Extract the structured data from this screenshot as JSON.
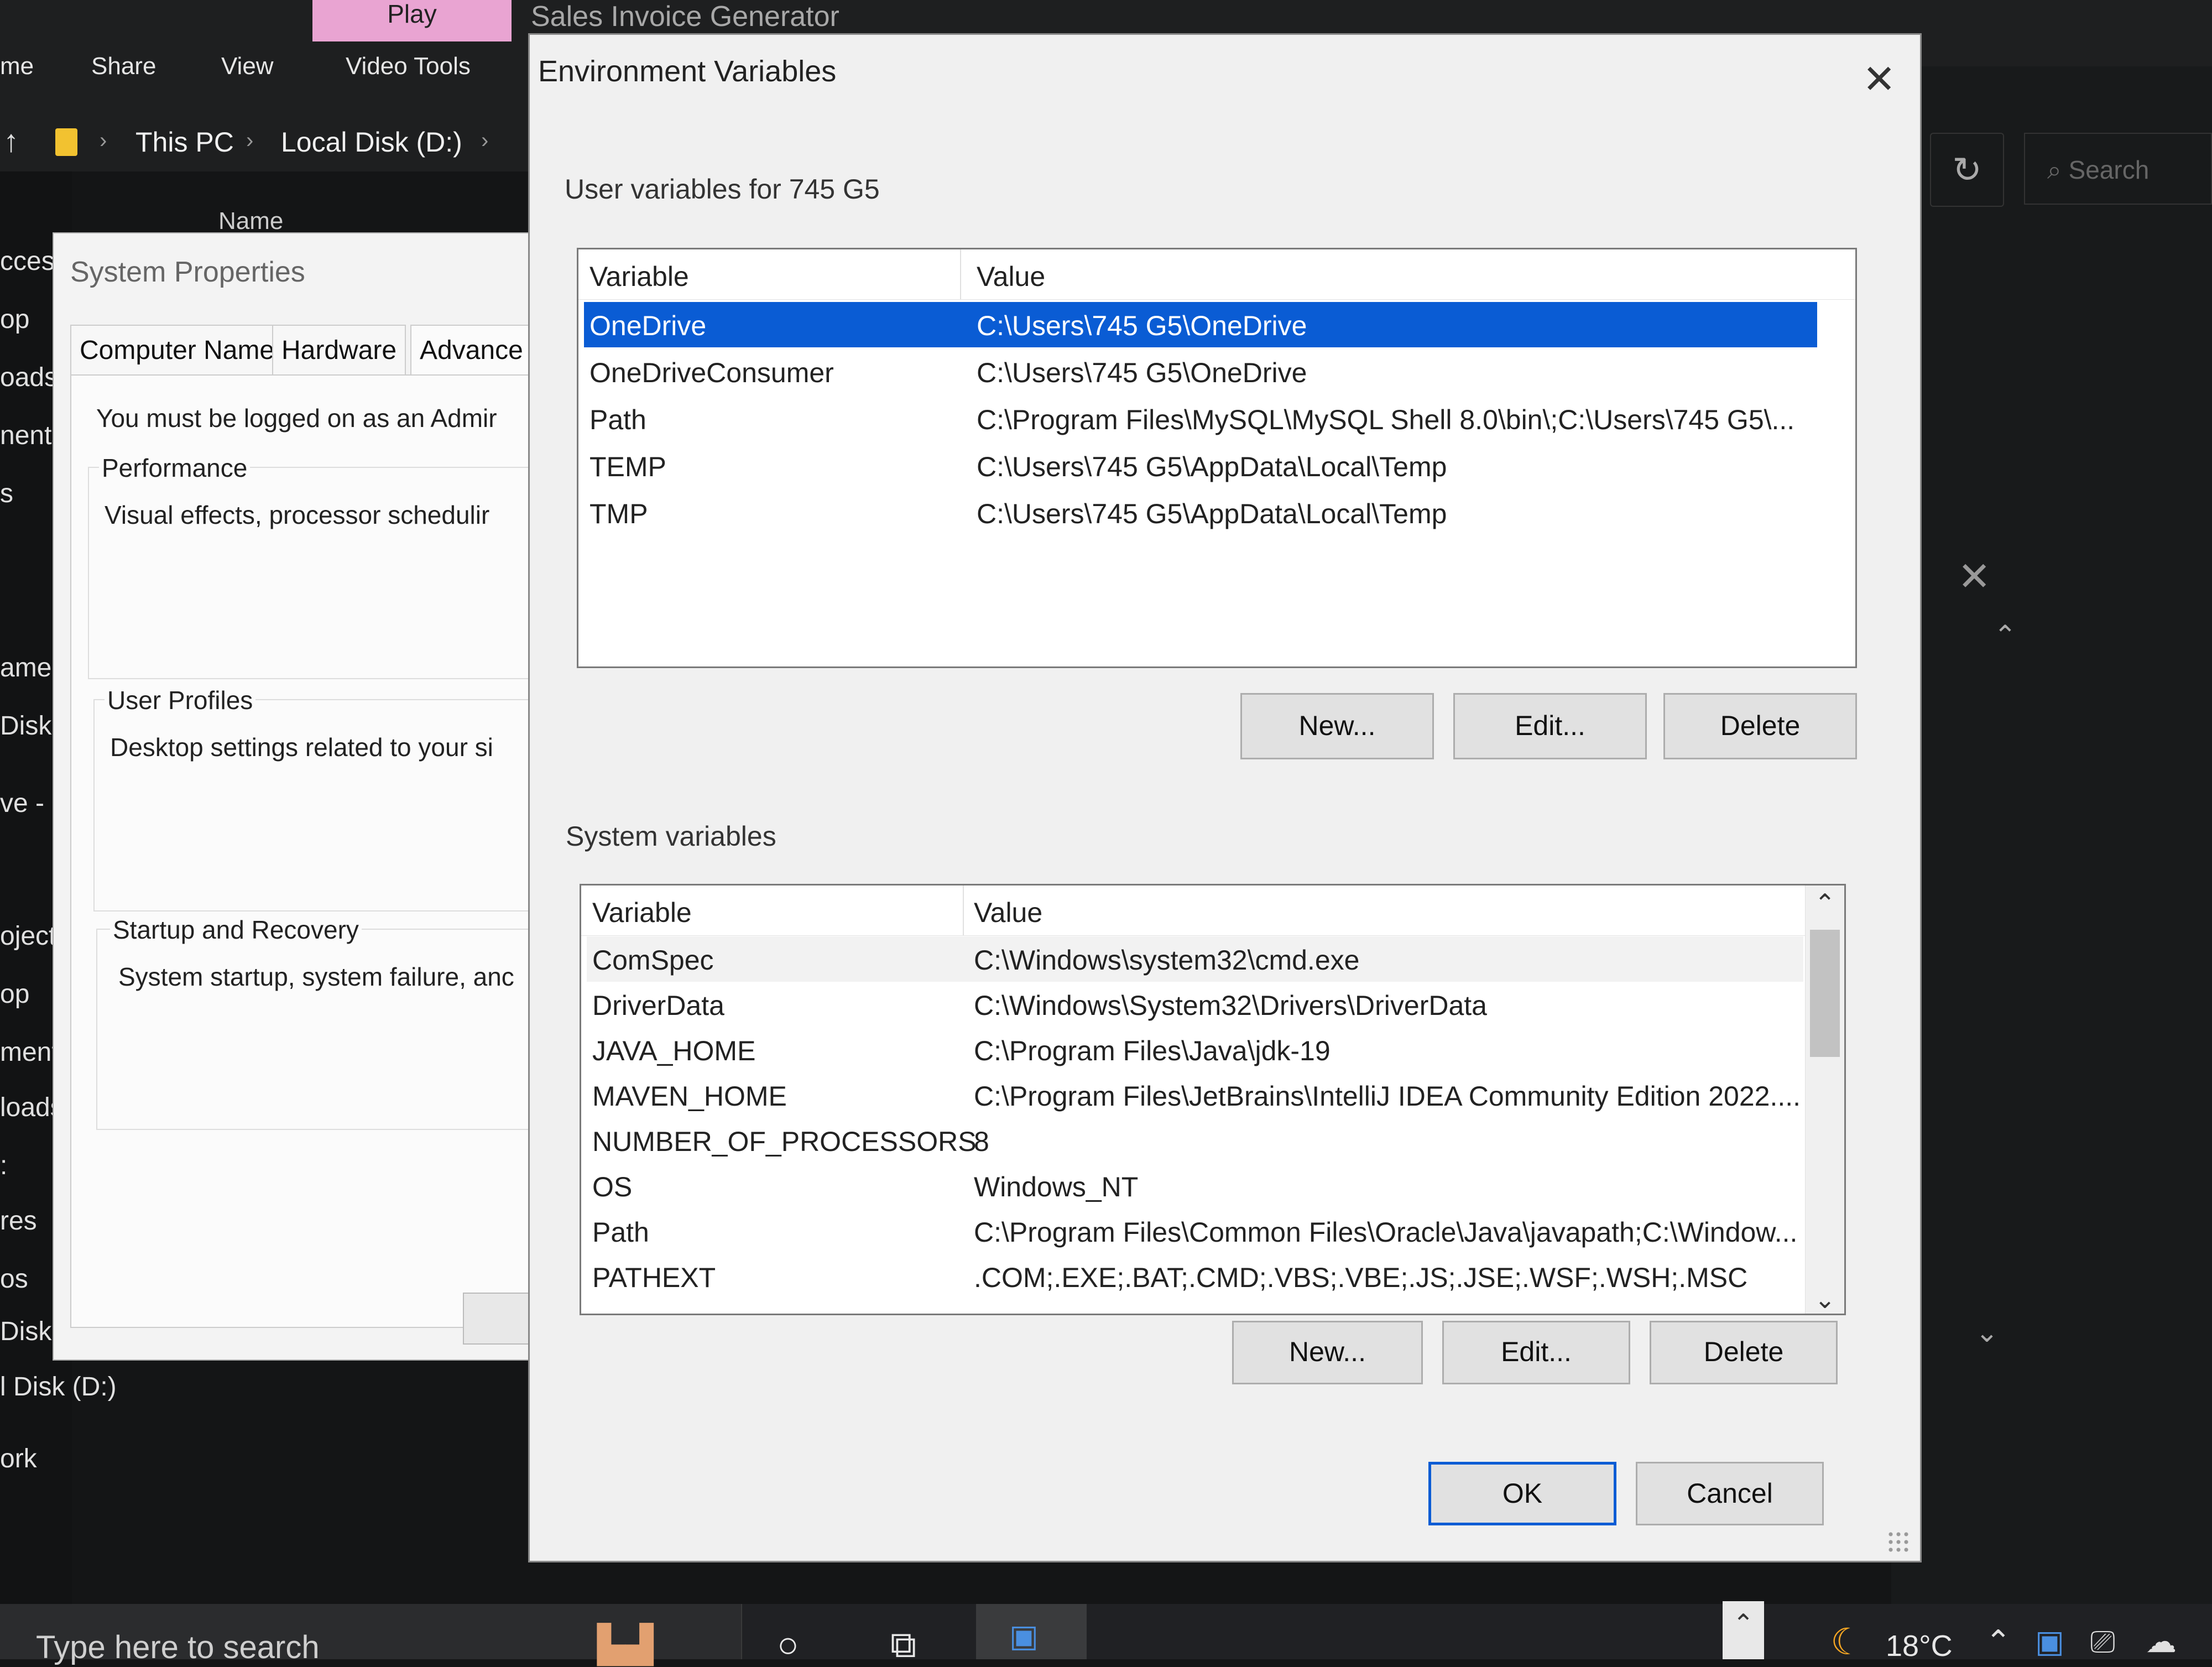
{
  "explorer": {
    "play_tab": "Play",
    "window_title": "Sales Invoice Generator",
    "ribbon": [
      "me",
      "Share",
      "View",
      "Video Tools"
    ],
    "breadcrumb": [
      "This PC",
      "Local Disk (D:)"
    ],
    "column_name": "Name",
    "nav_items": [
      "ccess",
      "op",
      "oads",
      "nents",
      "s",
      "amer",
      "Disk",
      "ve - P",
      "ojects",
      "op",
      "ments",
      "loads",
      ":",
      "res",
      "os",
      "Disk",
      "l Disk (D:)",
      "ork"
    ],
    "search_placeholder": "Search"
  },
  "system_properties": {
    "title": "System Properties",
    "tabs": [
      "Computer Name",
      "Hardware",
      "Advance"
    ],
    "admin_notice": "You must be logged on as an Admir",
    "performance": {
      "label": "Performance",
      "desc": "Visual effects, processor schedulir"
    },
    "user_profiles": {
      "label": "User Profiles",
      "desc": "Desktop settings related to your si"
    },
    "startup": {
      "label": "Startup and Recovery",
      "desc": "System startup, system failure, anc"
    }
  },
  "env_dialog": {
    "title": "Environment Variables",
    "user_section": "User variables for 745 G5",
    "columns": {
      "variable": "Variable",
      "value": "Value"
    },
    "user_rows": [
      {
        "variable": "OneDrive",
        "value": "C:\\Users\\745 G5\\OneDrive",
        "selected": true
      },
      {
        "variable": "OneDriveConsumer",
        "value": "C:\\Users\\745 G5\\OneDrive"
      },
      {
        "variable": "Path",
        "value": "C:\\Program Files\\MySQL\\MySQL Shell 8.0\\bin\\;C:\\Users\\745 G5\\..."
      },
      {
        "variable": "TEMP",
        "value": "C:\\Users\\745 G5\\AppData\\Local\\Temp"
      },
      {
        "variable": "TMP",
        "value": "C:\\Users\\745 G5\\AppData\\Local\\Temp"
      }
    ],
    "user_buttons": {
      "new": "New...",
      "edit": "Edit...",
      "delete": "Delete"
    },
    "system_section": "System variables",
    "system_rows": [
      {
        "variable": "ComSpec",
        "value": "C:\\Windows\\system32\\cmd.exe"
      },
      {
        "variable": "DriverData",
        "value": "C:\\Windows\\System32\\Drivers\\DriverData"
      },
      {
        "variable": "JAVA_HOME",
        "value": "C:\\Program Files\\Java\\jdk-19"
      },
      {
        "variable": "MAVEN_HOME",
        "value": "C:\\Program Files\\JetBrains\\IntelliJ IDEA Community Edition 2022...."
      },
      {
        "variable": "NUMBER_OF_PROCESSORS",
        "value": "8"
      },
      {
        "variable": "OS",
        "value": "Windows_NT"
      },
      {
        "variable": "Path",
        "value": "C:\\Program Files\\Common Files\\Oracle\\Java\\javapath;C:\\Window..."
      },
      {
        "variable": "PATHEXT",
        "value": ".COM;.EXE;.BAT;.CMD;.VBS;.VBE;.JS;.JSE;.WSF;.WSH;.MSC"
      }
    ],
    "system_buttons": {
      "new": "New...",
      "edit": "Edit...",
      "delete": "Delete"
    },
    "ok": "OK",
    "cancel": "Cancel"
  },
  "taskbar": {
    "search_text": "Type here to search",
    "temperature": "18°C"
  },
  "colors": {
    "selection": "#0a5cd4",
    "accent_tab": "#e9a4d2"
  }
}
